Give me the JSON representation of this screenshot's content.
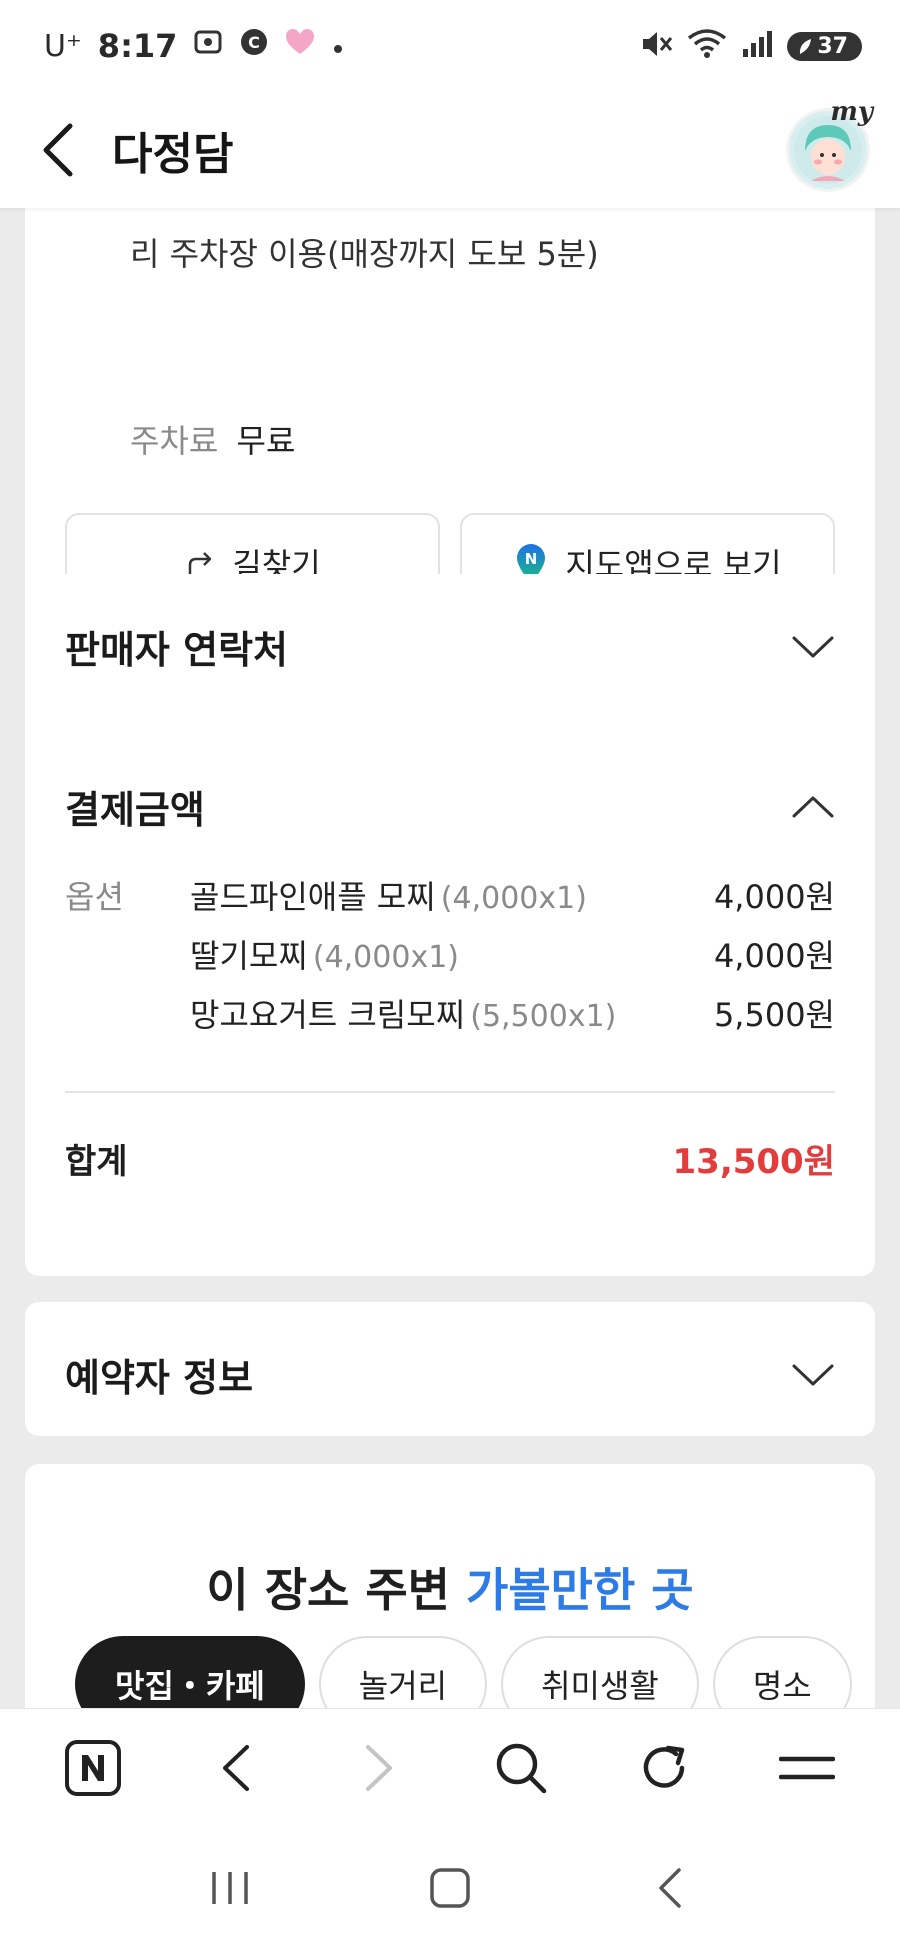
{
  "status_bar": {
    "carrier": "U⁺",
    "time": "8:17",
    "battery": "37"
  },
  "header": {
    "title": "다정담",
    "avatar_badge": "my"
  },
  "location": {
    "partial_line": "리 주차장 이용(매장까지 도보 5분)",
    "parking_label": "주차료",
    "parking_value": "무료",
    "route_button": "길찾기",
    "map_button": "지도앱으로 보기"
  },
  "seller_contact": {
    "title": "판매자 연락처"
  },
  "payment": {
    "title": "결제금액",
    "option_label": "옵션",
    "items": [
      {
        "name": "골드파인애플 모찌",
        "qty": "(4,000x1)",
        "price": "4,000원"
      },
      {
        "name": "딸기모찌",
        "qty": "(4,000x1)",
        "price": "4,000원"
      },
      {
        "name": "망고요거트 크림모찌",
        "qty": "(5,500x1)",
        "price": "5,500원"
      }
    ],
    "total_label": "합계",
    "total_amount": "13,500원"
  },
  "booker_info": {
    "title": "예약자 정보"
  },
  "nearby": {
    "title_prefix": "이 장소 주변",
    "title_accent": "가볼만한 곳",
    "chips": [
      "맛집・카페",
      "놀거리",
      "취미생활",
      "명소"
    ]
  },
  "icons": {
    "back": "back-arrow-icon",
    "route": "route-arrow-icon",
    "map": "naver-map-pin-icon",
    "chevron_down": "chevron-down-icon",
    "chevron_up": "chevron-up-icon"
  },
  "colors": {
    "accent_blue": "#2d7be6",
    "total_red": "#e23c3c",
    "map_pin_green": "#19c37d",
    "map_pin_blue": "#1f6fe5"
  }
}
